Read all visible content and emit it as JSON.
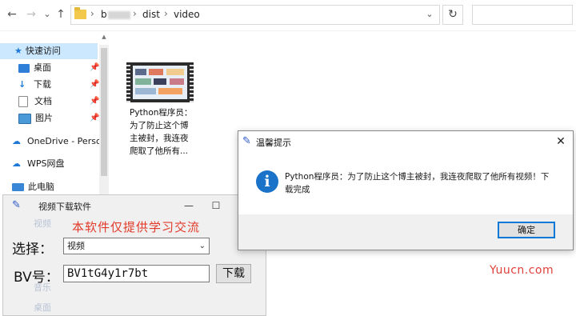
{
  "explorer": {
    "nav": {
      "back": "←",
      "forward": "→",
      "recent": "⌄",
      "up": "↑"
    },
    "breadcrumb": [
      "b",
      "dist",
      "video"
    ],
    "separator": "›",
    "addr_dropdown": "⌄",
    "refresh": "↻",
    "sidebar": {
      "items": [
        {
          "label": "快速访问",
          "icon": "star-icon",
          "pinned": false,
          "selected": true
        },
        {
          "label": "桌面",
          "icon": "desktop-icon",
          "pinned": true
        },
        {
          "label": "下载",
          "icon": "download-icon",
          "pinned": true
        },
        {
          "label": "文档",
          "icon": "document-icon",
          "pinned": true
        },
        {
          "label": "图片",
          "icon": "picture-icon",
          "pinned": true
        },
        {
          "label": "OneDrive - Perso",
          "icon": "cloud-icon",
          "pinned": false
        },
        {
          "label": "WPS网盘",
          "icon": "cloud-icon",
          "pinned": false
        },
        {
          "label": "此电脑",
          "icon": "computer-icon",
          "pinned": false
        }
      ],
      "pin_glyph": "📌"
    },
    "file": {
      "name_lines": [
        "Python程序员：",
        "为了防止这个博",
        "主被封，我连夜",
        "爬取了他所有..."
      ]
    }
  },
  "downloader": {
    "title": "视频下载软件",
    "banner": "本软件仅提供学习交流",
    "select_label": "选择：",
    "select_value": "视频",
    "bv_label": "BV号：",
    "bv_value": "BV1tG4y1r7bt",
    "download_button": "下载",
    "minimize": "—",
    "maximize": "☐",
    "ghost_items": [
      "视频",
      "音乐",
      "桌面"
    ]
  },
  "message_box": {
    "title": "温馨提示",
    "close": "✕",
    "icon": "i",
    "message": "Python程序员：为了防止这个博主被封，我连夜爬取了他所有视频！下载完成",
    "ok_button": "确定"
  },
  "watermark": "Yuucn.com",
  "colors": {
    "accent": "#0078d7",
    "info": "#1a73c8",
    "banner": "#e23a2a"
  }
}
